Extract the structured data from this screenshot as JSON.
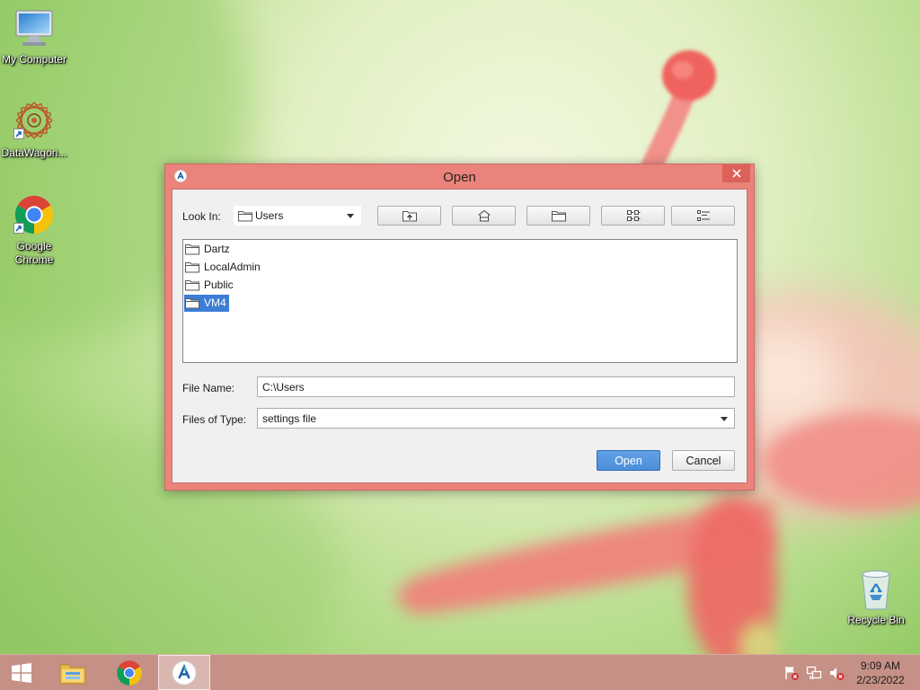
{
  "desktop": {
    "icons": [
      {
        "label": "My Computer",
        "icon": "computer-icon"
      },
      {
        "label": "DataWagon...",
        "icon": "datawagon-icon",
        "shortcut": true
      },
      {
        "label": "Google Chrome",
        "icon": "chrome-icon",
        "shortcut": true
      },
      {
        "label": "Recycle Bin",
        "icon": "recycle-bin-icon"
      }
    ]
  },
  "dialog": {
    "title": "Open",
    "app_icon": "java-app-icon",
    "close_icon": "close-icon",
    "look_in": {
      "label": "Look In:",
      "value": "Users",
      "icon": "folder-icon"
    },
    "toolbar": [
      {
        "icon": "up-one-level-icon"
      },
      {
        "icon": "home-icon"
      },
      {
        "icon": "new-folder-icon"
      },
      {
        "icon": "list-view-icon"
      },
      {
        "icon": "details-view-icon"
      }
    ],
    "files": [
      {
        "name": "Dartz",
        "icon": "folder-icon",
        "selected": false
      },
      {
        "name": "LocalAdmin",
        "icon": "folder-icon",
        "selected": false
      },
      {
        "name": "Public",
        "icon": "folder-icon",
        "selected": false
      },
      {
        "name": "VM4",
        "icon": "folder-icon",
        "selected": true
      }
    ],
    "file_name": {
      "label": "File Name:",
      "value": "C:\\Users"
    },
    "files_of_type": {
      "label": "Files of Type:",
      "value": "settings file"
    },
    "buttons": {
      "open": "Open",
      "cancel": "Cancel"
    }
  },
  "taskbar": {
    "start_icon": "windows-start-icon",
    "pinned": [
      "file-explorer-icon",
      "chrome-icon",
      "java-app-icon"
    ],
    "active": "java-app-icon",
    "tray_icons": [
      "action-center-flag-icon",
      "network-icon",
      "volume-muted-icon"
    ],
    "clock": {
      "time": "9:09 AM",
      "date": "2/23/2022"
    }
  },
  "colors": {
    "frame_color": "#e9837b",
    "close_button_color": "#dc6259",
    "selection_color": "#3c7dd6",
    "open_button_color": "#4d8fd8",
    "taskbar_color": "#c59085"
  }
}
